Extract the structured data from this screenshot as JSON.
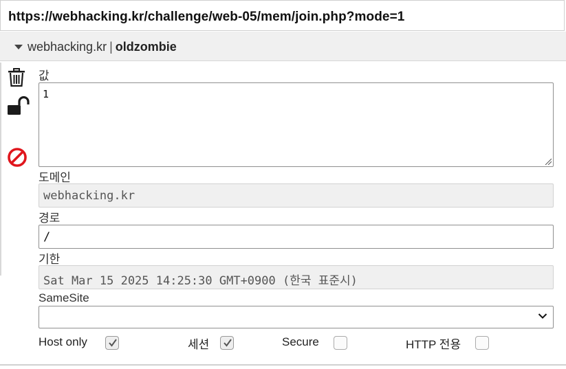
{
  "address_bar": {
    "url": "https://webhacking.kr/challenge/web-05/mem/join.php?mode=1"
  },
  "cookie_header": {
    "domain": "webhacking.kr",
    "separator": "|",
    "name": "oldzombie"
  },
  "actions": {
    "delete_icon": "trash-icon",
    "lock_icon": "unlock-icon",
    "block_icon": "block-icon"
  },
  "fields": {
    "value_label": "값",
    "value": "1",
    "domain_label": "도메인",
    "domain_value": "webhacking.kr",
    "path_label": "경로",
    "path_value": "/",
    "expires_label": "기한",
    "expires_value": "Sat Mar 15 2025 14:25:30 GMT+0900 (한국 표준시)",
    "samesite_label": "SameSite",
    "samesite_value": ""
  },
  "flags": {
    "host_only_label": "Host only",
    "host_only": true,
    "session_label": "세션",
    "session": true,
    "secure_label": "Secure",
    "secure": false,
    "http_only_label": "HTTP 전용",
    "http_only": false
  },
  "colors": {
    "block_red": "#e0161d",
    "icon_dark": "#1b1b1b"
  }
}
